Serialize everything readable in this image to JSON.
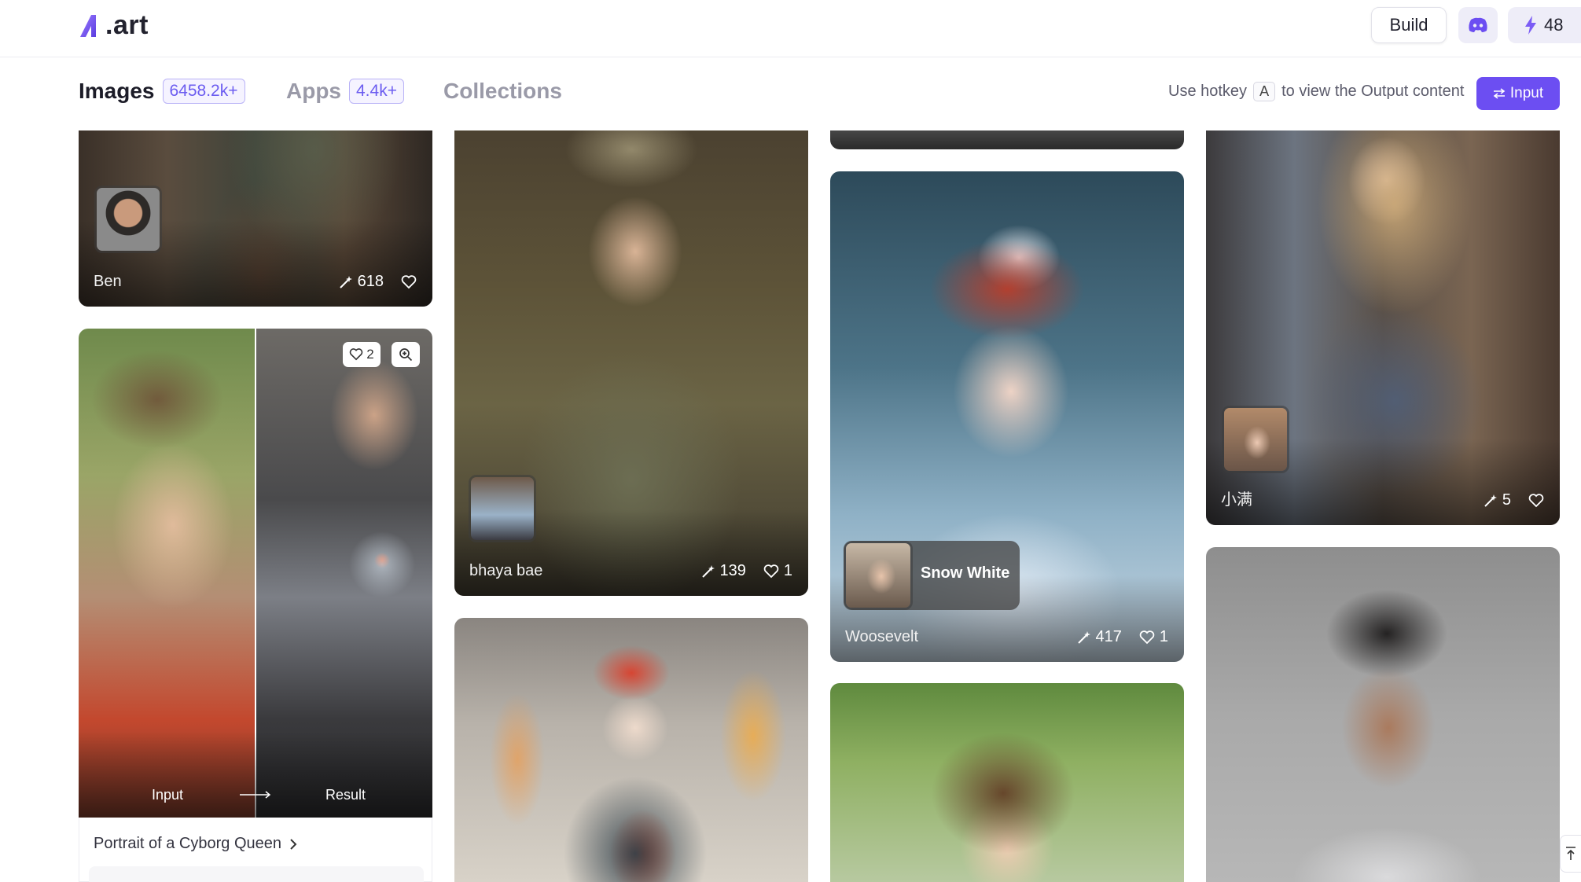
{
  "header": {
    "logo_text": ".art",
    "build_label": "Build",
    "credits": "48"
  },
  "tabs": [
    {
      "label": "Images",
      "count": "6458.2k+"
    },
    {
      "label": "Apps",
      "count": "4.4k+"
    },
    {
      "label": "Collections"
    }
  ],
  "hotkey": {
    "prefix": "Use hotkey",
    "key": "A",
    "suffix": "to view the Output content"
  },
  "input_button": "Input",
  "cards": {
    "ben": {
      "author": "Ben",
      "remixes": "618"
    },
    "cyborg": {
      "likes": "2",
      "left_label": "Input",
      "right_label": "Result",
      "caption": "Portrait of a Cyborg Queen"
    },
    "soldier": {
      "author": "bhaya bae",
      "remixes": "139",
      "likes": "1"
    },
    "snow": {
      "title": "Snow White",
      "author": "Woosevelt",
      "remixes": "417",
      "likes": "1"
    },
    "xiaoman": {
      "author": "小满",
      "remixes": "5"
    }
  },
  "colors": {
    "accent": "#6c4ef2",
    "badge_text": "#6b5cf0"
  }
}
